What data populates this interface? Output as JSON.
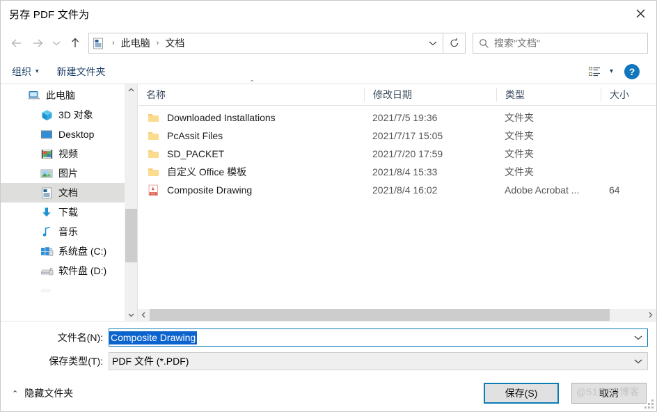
{
  "window": {
    "title": "另存 PDF 文件为",
    "close_icon": "close-icon"
  },
  "nav": {
    "back_icon": "arrow-left-icon",
    "forward_icon": "arrow-right-icon",
    "recent_icon": "chevron-down-icon",
    "up_icon": "arrow-up-icon",
    "breadcrumb": {
      "folder_icon": "documents-icon",
      "items": [
        "此电脑",
        "文档"
      ],
      "separator": "›"
    },
    "address_dropdown_icon": "chevron-down-icon",
    "refresh_icon": "refresh-icon"
  },
  "search": {
    "icon": "search-icon",
    "placeholder": "搜索\"文档\"",
    "value": ""
  },
  "toolbar": {
    "organize_label": "组织",
    "organize_caret": "▾",
    "new_folder_label": "新建文件夹",
    "view_icon": "list-view-icon",
    "view_caret": "▾",
    "help_label": "?"
  },
  "sidebar": {
    "items": [
      {
        "label": "此电脑",
        "icon": "computer-icon",
        "level": 0,
        "selected": false
      },
      {
        "label": "3D 对象",
        "icon": "3d-objects-icon",
        "level": 1,
        "selected": false
      },
      {
        "label": "Desktop",
        "icon": "desktop-icon",
        "level": 1,
        "selected": false
      },
      {
        "label": "视频",
        "icon": "videos-icon",
        "level": 1,
        "selected": false
      },
      {
        "label": "图片",
        "icon": "pictures-icon",
        "level": 1,
        "selected": false
      },
      {
        "label": "文档",
        "icon": "documents-icon",
        "level": 1,
        "selected": true
      },
      {
        "label": "下载",
        "icon": "downloads-icon",
        "level": 1,
        "selected": false
      },
      {
        "label": "音乐",
        "icon": "music-icon",
        "level": 1,
        "selected": false
      },
      {
        "label": "系统盘 (C:)",
        "icon": "windows-drive-icon",
        "level": 1,
        "selected": false
      },
      {
        "label": "软件盘 (D:)",
        "icon": "drive-icon",
        "level": 1,
        "selected": false
      }
    ],
    "scroll": {
      "up_icon": "chevron-up-icon",
      "down_icon": "chevron-down-icon"
    }
  },
  "filelist": {
    "columns": [
      {
        "label": "名称",
        "key": "name"
      },
      {
        "label": "修改日期",
        "key": "date"
      },
      {
        "label": "类型",
        "key": "type"
      },
      {
        "label": "大小",
        "key": "size"
      }
    ],
    "sort_caret": "⌃",
    "rows": [
      {
        "name": "Downloaded Installations",
        "date": "2021/7/5 19:36",
        "type": "文件夹",
        "size": "",
        "icon": "folder-icon"
      },
      {
        "name": "PcAssit Files",
        "date": "2021/7/17 15:05",
        "type": "文件夹",
        "size": "",
        "icon": "folder-icon"
      },
      {
        "name": "SD_PACKET",
        "date": "2021/7/20 17:59",
        "type": "文件夹",
        "size": "",
        "icon": "folder-icon"
      },
      {
        "name": "自定义 Office 模板",
        "date": "2021/8/4 15:33",
        "type": "文件夹",
        "size": "",
        "icon": "folder-icon"
      },
      {
        "name": "Composite Drawing",
        "date": "2021/8/4 16:02",
        "type": "Adobe Acrobat ...",
        "size": "64",
        "icon": "pdf-file-icon"
      }
    ],
    "hscroll": {
      "left_icon": "chevron-left-icon",
      "right_icon": "chevron-right-icon"
    }
  },
  "form": {
    "filename_label": "文件名(N):",
    "filename_value": "Composite Drawing",
    "filetype_label": "保存类型(T):",
    "filetype_value": "PDF 文件 (*.PDF)",
    "dropdown_icon": "chevron-down-icon"
  },
  "footer": {
    "hide_folders_label": "隐藏文件夹",
    "hide_folders_caret": "⌃",
    "save_label": "保存(S)",
    "cancel_label": "取消"
  },
  "watermark": {
    "text": "@51CTO博客"
  },
  "colors": {
    "accent": "#0c7eb5",
    "selection": "#0b63ce",
    "sidebar_selected": "#dededd",
    "toolbar_link": "#1b3f66",
    "help_blue": "#1176bc"
  }
}
